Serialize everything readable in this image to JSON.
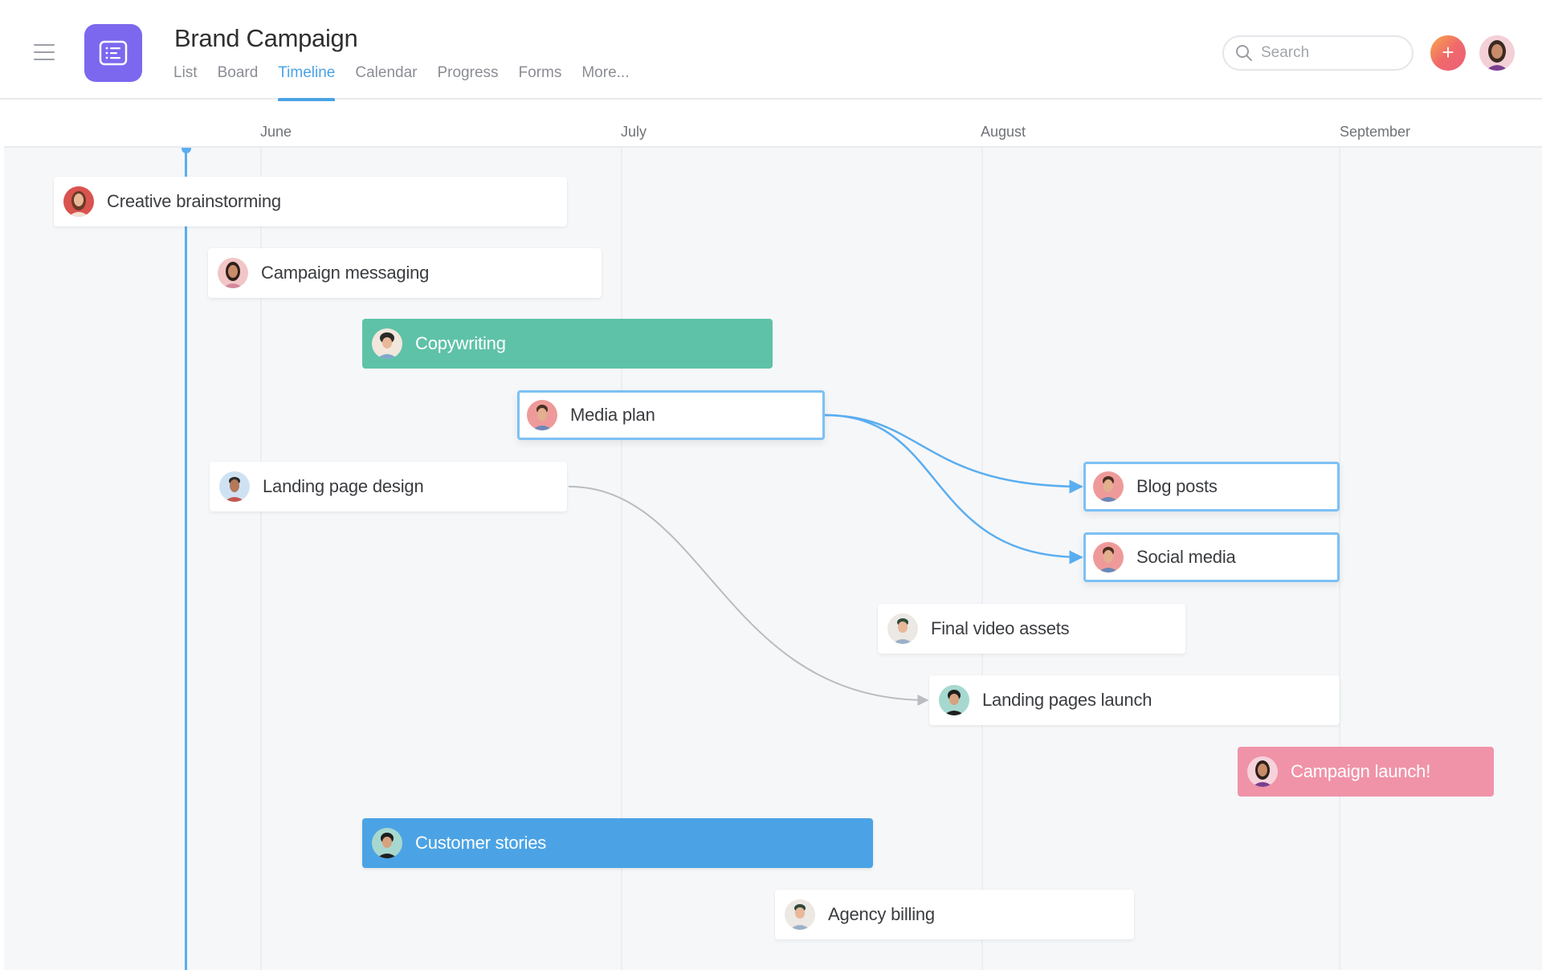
{
  "header": {
    "project_title": "Brand Campaign",
    "app_icon": "project-list-icon",
    "menu_icon": "hamburger-menu-icon",
    "tabs": [
      {
        "label": "List",
        "active": false
      },
      {
        "label": "Board",
        "active": false
      },
      {
        "label": "Timeline",
        "active": true
      },
      {
        "label": "Calendar",
        "active": false
      },
      {
        "label": "Progress",
        "active": false
      },
      {
        "label": "Forms",
        "active": false
      },
      {
        "label": "More...",
        "active": false
      }
    ],
    "search": {
      "placeholder": "Search",
      "value": ""
    },
    "add_button_label": "+",
    "colors": {
      "accent": "#4aa3e6",
      "app_icon": "#7b68ee",
      "add_button": "#f06a6a"
    }
  },
  "timeline": {
    "months": [
      "June",
      "July",
      "August",
      "September"
    ],
    "today_marker_color": "#5aaef0",
    "tasks": [
      {
        "name": "Creative brainstorming",
        "style": "default",
        "avatar_color": "#d9534f"
      },
      {
        "name": "Campaign messaging",
        "style": "default",
        "avatar_color": "#f2c6c6"
      },
      {
        "name": "Copywriting",
        "style": "green",
        "avatar_color": "#f1e7dc",
        "color": "#5ec2a8"
      },
      {
        "name": "Media plan",
        "style": "selected",
        "avatar_color": "#ef9a9a"
      },
      {
        "name": "Landing page design",
        "style": "default",
        "avatar_color": "#cfe2f3"
      },
      {
        "name": "Blog posts",
        "style": "selected",
        "avatar_color": "#ef9a9a"
      },
      {
        "name": "Social media",
        "style": "selected",
        "avatar_color": "#ef9a9a"
      },
      {
        "name": "Final video assets",
        "style": "default",
        "avatar_color": "#ece8e3"
      },
      {
        "name": "Landing pages launch",
        "style": "default",
        "avatar_color": "#a7d8cf"
      },
      {
        "name": "Campaign launch!",
        "style": "pink",
        "avatar_color": "#f6d3dc",
        "color": "#f093a8"
      },
      {
        "name": "Customer stories",
        "style": "blue",
        "avatar_color": "#a7d8cf",
        "color": "#4ba3e5"
      },
      {
        "name": "Agency billing",
        "style": "default",
        "avatar_color": "#ece8e3"
      }
    ],
    "dependencies": [
      {
        "from": "Media plan",
        "to": "Blog posts",
        "color": "#5aaef0"
      },
      {
        "from": "Media plan",
        "to": "Social media",
        "color": "#5aaef0"
      },
      {
        "from": "Landing page design",
        "to": "Landing pages launch",
        "color": "#b9bcc1"
      }
    ]
  }
}
